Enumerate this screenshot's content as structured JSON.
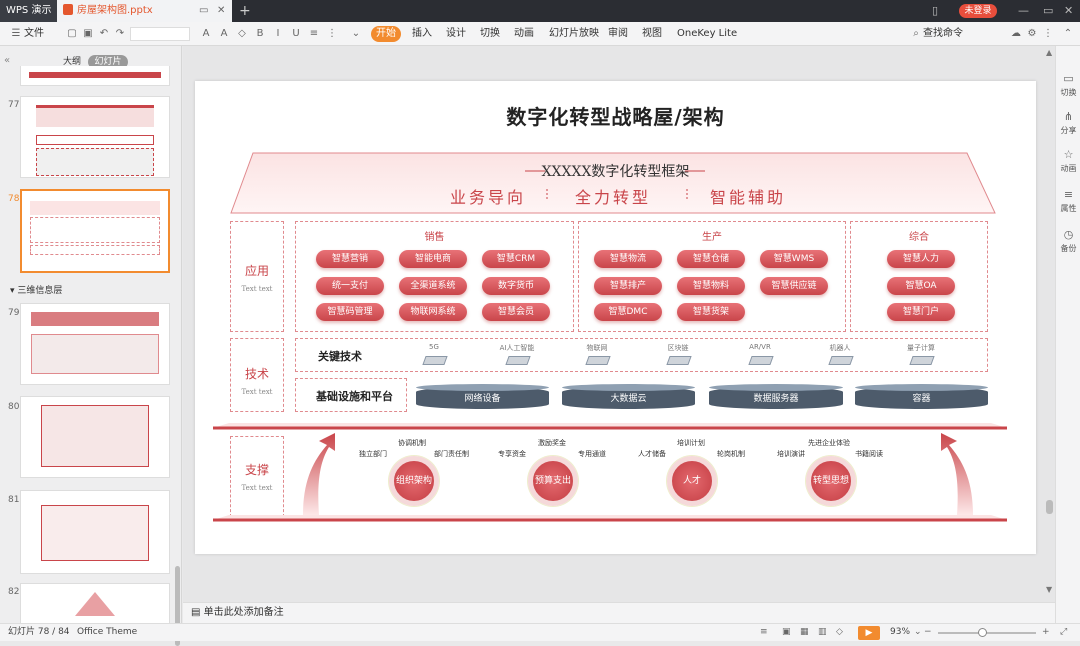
{
  "titlebar": {
    "app": "WPS 演示",
    "doc_tab": "房屋架构图.pptx",
    "login": "未登录"
  },
  "ribbon": {
    "file": "文件",
    "tabs": [
      "开始",
      "插入",
      "设计",
      "切换",
      "动画",
      "幻灯片放映",
      "审阅",
      "视图",
      "OneKey Lite"
    ],
    "active": "开始",
    "search": "查找命令"
  },
  "left_panel": {
    "tab_outline": "大纲",
    "tab_slides": "幻灯片",
    "section": "三维信息层",
    "slides": [
      "77",
      "78",
      "79",
      "80",
      "81",
      "82"
    ]
  },
  "right_panel": [
    "切换",
    "分享",
    "动画",
    "属性",
    "备份"
  ],
  "slide": {
    "title": "数字化转型战略屋/架构",
    "roof_title": "XXXXX数字化转型框架",
    "roof_subs": [
      "业务导向",
      "全力转型",
      "智能辅助"
    ],
    "rows": {
      "app": "应用",
      "tech": "技术",
      "support": "支撑",
      "sub": "Text text"
    },
    "sales": {
      "title": "销售",
      "items": [
        "智慧营销",
        "智能电商",
        "智慧CRM",
        "统一支付",
        "全渠道系统",
        "数字货币",
        "智慧码管理",
        "物联网系统",
        "智慧会员"
      ]
    },
    "production": {
      "title": "生产",
      "items": [
        "智慧物流",
        "智慧仓储",
        "智慧WMS",
        "智慧排产",
        "智慧物料",
        "智慧供应链",
        "智慧DMC",
        "智慧货架"
      ]
    },
    "general": {
      "title": "综合",
      "items": [
        "智慧人力",
        "智慧OA",
        "智慧门户"
      ]
    },
    "key_tech": {
      "label": "关键技术",
      "items": [
        "5G",
        "AI人工智能",
        "物联网",
        "区块链",
        "AR/VR",
        "机器人",
        "量子计算"
      ]
    },
    "infra": {
      "label": "基础设施和平台",
      "items": [
        "网络设备",
        "大数据云",
        "数据服务器",
        "容器"
      ]
    },
    "support": [
      {
        "circle": "组织架构",
        "tags": [
          "协调机制",
          "独立部门",
          "部门责任制"
        ]
      },
      {
        "circle": "预算支出",
        "tags": [
          "激励奖金",
          "专享资金",
          "专用通道"
        ]
      },
      {
        "circle": "人才",
        "tags": [
          "培训计划",
          "人才储备",
          "轮岗机制"
        ]
      },
      {
        "circle": "转型思想",
        "tags": [
          "先进企业体验",
          "培训演讲",
          "书籍阅读"
        ]
      }
    ]
  },
  "notes": "单击此处添加备注",
  "status": {
    "slide": "幻灯片 78 / 84",
    "theme": "Office Theme",
    "zoom": "93%"
  }
}
